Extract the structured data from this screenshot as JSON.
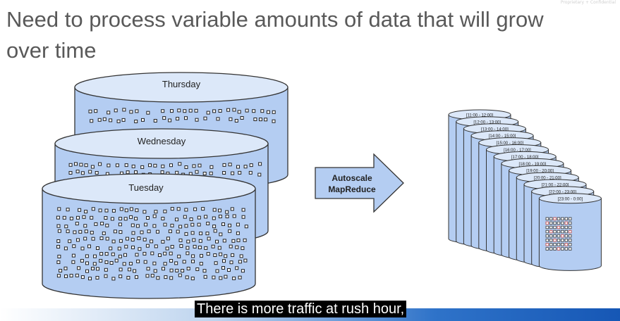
{
  "slide": {
    "title": "Need to process variable amounts of data that will grow over time",
    "watermark": "Proprietary + Confidential"
  },
  "cylinders": [
    {
      "label": "Thursday",
      "rows": 2
    },
    {
      "label": "Wednesday",
      "rows": 2
    },
    {
      "label": "Tuesday",
      "rows": 10
    }
  ],
  "arrow": {
    "line1": "Autoscale",
    "line2": "MapReduce"
  },
  "hourly_cylinders": [
    "[11:00 - 12:00]",
    "[12:00 - 13:00]",
    "[13:00 - 14:00]",
    "[14:00 - 15:00]",
    "[15:00 - 16:00]",
    "[16:00 - 17:00]",
    "[17:00 - 18:00]",
    "[18:00 - 19:00]",
    "[19:00 - 20:00]",
    "[20:00 - 21:00]",
    "[21:00 - 22:00]",
    "[22:00 - 23:00]",
    "[23:00 - 0:00]"
  ],
  "subtitle": {
    "text": "There is more traffic at rush hour,"
  },
  "colors": {
    "cylinder_fill": "#b4cdf2",
    "cylinder_top": "#dce8f9",
    "cylinder_stroke": "#333333",
    "arrow_fill": "#b4cdf2",
    "dot_highlight": "#c0504d",
    "title_text": "#595959"
  }
}
